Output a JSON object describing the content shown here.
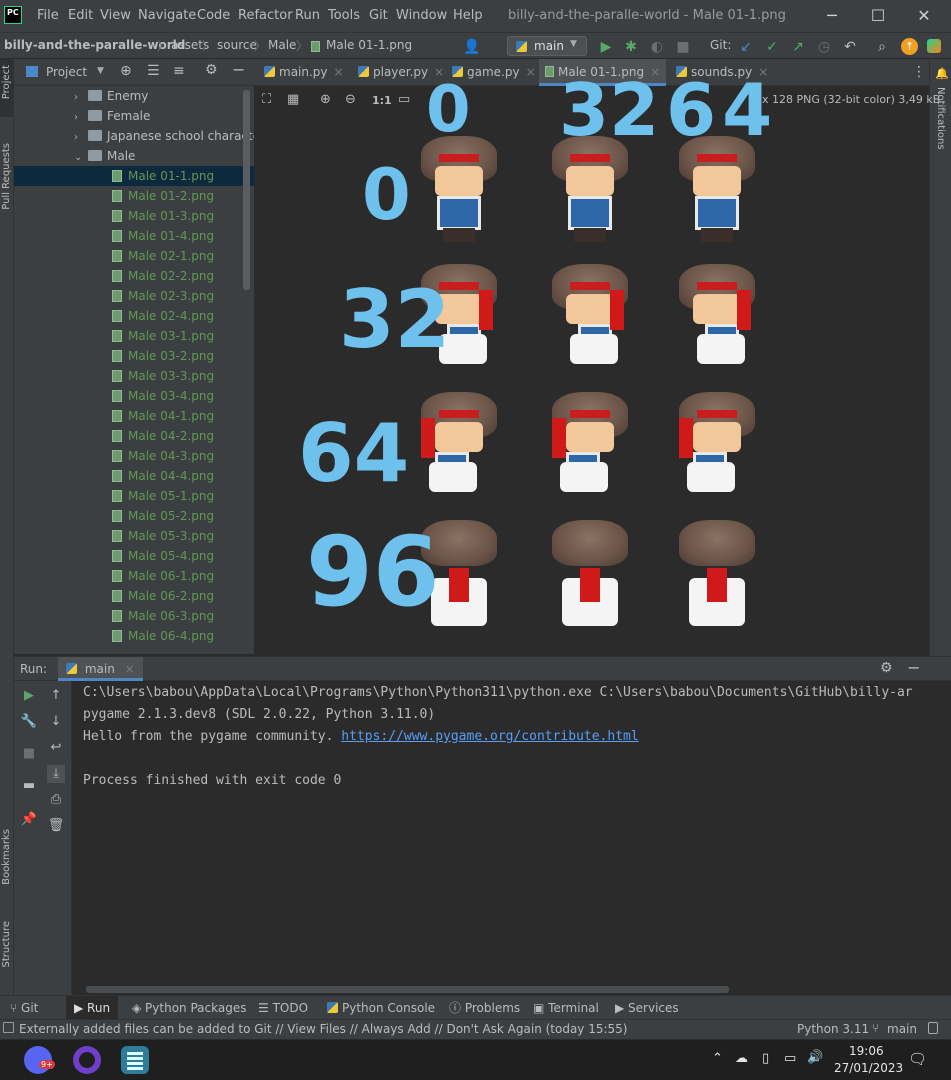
{
  "window": {
    "app_logo": "PC",
    "menu": [
      "File",
      "Edit",
      "View",
      "Navigate",
      "Code",
      "Refactor",
      "Run",
      "Tools",
      "Git",
      "Window",
      "Help"
    ],
    "title": "billy-and-the-paralle-world - Male 01-1.png",
    "controls": {
      "minimize": "─",
      "maximize": "☐",
      "close": "✕"
    }
  },
  "navbar": {
    "breadcrumbs": [
      "billy-and-the-paralle-world",
      "assets",
      "source",
      "Male",
      "Male 01-1.png"
    ],
    "run_config": "main",
    "git_label": "Git:"
  },
  "left_strip": {
    "project": "Project",
    "pull_requests": "Pull Requests",
    "bookmarks": "Bookmarks",
    "structure": "Structure"
  },
  "right_strip": {
    "notifications": "Notifications"
  },
  "project_panel": {
    "title": "Project",
    "folders": [
      "Enemy",
      "Female",
      "Japanese school characters",
      "Male"
    ],
    "files": [
      "Male 01-1.png",
      "Male 01-2.png",
      "Male 01-3.png",
      "Male 01-4.png",
      "Male 02-1.png",
      "Male 02-2.png",
      "Male 02-3.png",
      "Male 02-4.png",
      "Male 03-1.png",
      "Male 03-2.png",
      "Male 03-3.png",
      "Male 03-4.png",
      "Male 04-1.png",
      "Male 04-2.png",
      "Male 04-3.png",
      "Male 04-4.png",
      "Male 05-1.png",
      "Male 05-2.png",
      "Male 05-3.png",
      "Male 05-4.png",
      "Male 06-1.png",
      "Male 06-2.png",
      "Male 06-3.png",
      "Male 06-4.png"
    ],
    "selected_file": "Male 01-1.png"
  },
  "editor_tabs": [
    {
      "label": "main.py",
      "type": "py"
    },
    {
      "label": "player.py",
      "type": "py"
    },
    {
      "label": "game.py",
      "type": "py"
    },
    {
      "label": "Male 01-1.png",
      "type": "png",
      "active": true
    },
    {
      "label": "sounds.py",
      "type": "py"
    }
  ],
  "image_viewer": {
    "zoom_1to1": "1:1",
    "info": "x 128 PNG (32-bit color) 3,49 kB",
    "annotations_columns": [
      "0",
      "32",
      "64"
    ],
    "annotations_rows": [
      "0",
      "32",
      "64",
      "96"
    ]
  },
  "run_panel": {
    "label": "Run:",
    "tab": "main",
    "console": [
      "C:\\Users\\babou\\AppData\\Local\\Programs\\Python\\Python311\\python.exe C:\\Users\\babou\\Documents\\GitHub\\billy-ar",
      "pygame 2.1.3.dev8 (SDL 2.0.22, Python 3.11.0)",
      "Hello from the pygame community. ",
      "",
      "Process finished with exit code 0"
    ],
    "link": "https://www.pygame.org/contribute.html"
  },
  "bottom_tabs": [
    "Git",
    "Run",
    "Python Packages",
    "TODO",
    "Python Console",
    "Problems",
    "Terminal",
    "Services"
  ],
  "status": {
    "message": "Externally added files can be added to Git // View Files // Always Add // Don't Ask Again (today 15:55)",
    "interpreter": "Python 3.11",
    "branch": "main"
  },
  "taskbar": {
    "discord_badge": "9+",
    "time": "19:06",
    "date": "27/01/2023"
  },
  "colors": {
    "accent": "#4a88c7",
    "green_file": "#629755",
    "link": "#589df6",
    "annotation": "#6ec1ec"
  }
}
